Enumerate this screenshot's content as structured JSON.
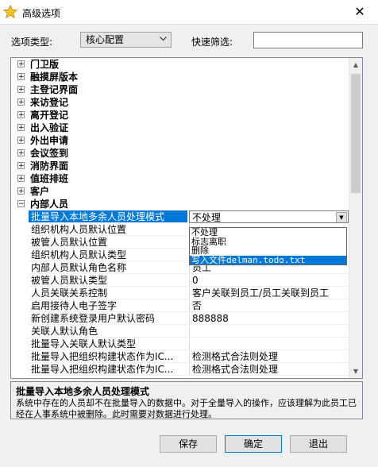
{
  "window": {
    "title": "高级选项",
    "close_glyph": "✕"
  },
  "filter": {
    "type_label": "选项类型:",
    "type_value": "核心配置",
    "quick_label": "快速筛选:",
    "quick_value": ""
  },
  "categories": [
    "门卫版",
    "融摸屏版本",
    "主登记界面",
    "来访登记",
    "离开登记",
    "出入验证",
    "外出申请",
    "会议签到",
    "消防界面",
    "值班排班",
    "客户",
    "内部人员"
  ],
  "expand_plus": "+",
  "expand_minus": "−",
  "properties": [
    {
      "name": "批量导入本地多余人员处理模式",
      "value": "不处理"
    },
    {
      "name": "组织机构人员默认位置",
      "value": ""
    },
    {
      "name": "被管人员默认位置",
      "value": ""
    },
    {
      "name": "组织机构人员默认类型",
      "value": ""
    },
    {
      "name": "内部人员默认角色名称",
      "value": "员工"
    },
    {
      "name": "被管人员默认类型",
      "value": "0"
    },
    {
      "name": "人员关联关系控制",
      "value": "客户关联到员工/员工关联到员工"
    },
    {
      "name": "启用接待人电子签字",
      "value": "否"
    },
    {
      "name": "新创建系统登录用户默认密码",
      "value": "888888"
    },
    {
      "name": "关联人默认角色",
      "value": ""
    },
    {
      "name": "批量导入关联人默认类型",
      "value": ""
    },
    {
      "name": "批量导入把组织构建状态作为IC...",
      "value": "检测格式合法则处理"
    },
    {
      "name": "批量导入把组织构建状态作为IC...",
      "value": "检测格式合法则处理"
    }
  ],
  "dropdown_options": [
    "不处理",
    "标志离职",
    "删除",
    "写入文件delman.todo.txt"
  ],
  "description": {
    "title": "批量导入本地多余人员处理模式",
    "text": "系统中存在的人员却不在批量导入的数据中。对于全量导入的操作，应该理解为此员工已经在人事系统中被删除。此时需要对数据进行处理。"
  },
  "buttons": {
    "save": "保存",
    "ok": "确定",
    "exit": "退出"
  }
}
